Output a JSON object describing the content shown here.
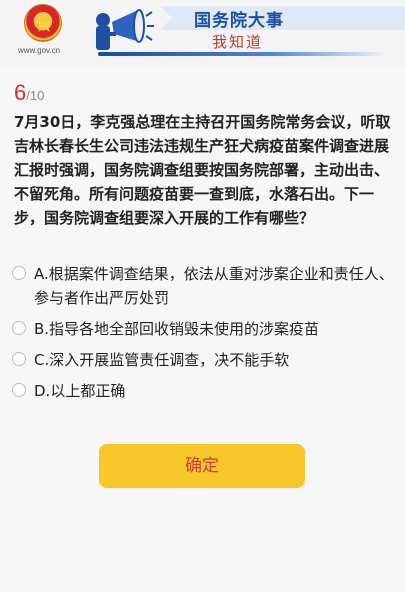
{
  "header": {
    "site_url": "www.gov.cn",
    "title": "国务院大事",
    "subtitle": "我知道",
    "emblem_icon": "national-emblem-icon",
    "megaphone_icon": "megaphone-icon"
  },
  "quiz": {
    "current": "6",
    "total": "/10",
    "question": "7月30日，李克强总理在主持召开国务院常务会议，听取吉林长春长生公司违法违规生产狂犬病疫苗案件调查进展汇报时强调，国务院调查组要按国务院部署，主动出击、不留死角。所有问题疫苗要一查到底，水落石出。下一步，国务院调查组要深入开展的工作有哪些？",
    "options": [
      {
        "label": "A.根据案件调查结果，依法从重对涉案企业和责任人、参与者作出严厉处罚"
      },
      {
        "label": "B.指导各地全部回收销毁未使用的涉案疫苗"
      },
      {
        "label": "C.深入开展监管责任调查，决不能手软"
      },
      {
        "label": "D.以上都正确"
      }
    ],
    "confirm_label": "确定"
  },
  "colors": {
    "accent_red": "#d62f24",
    "button_yellow": "#f7c629",
    "title_blue": "#1f4fa3"
  }
}
